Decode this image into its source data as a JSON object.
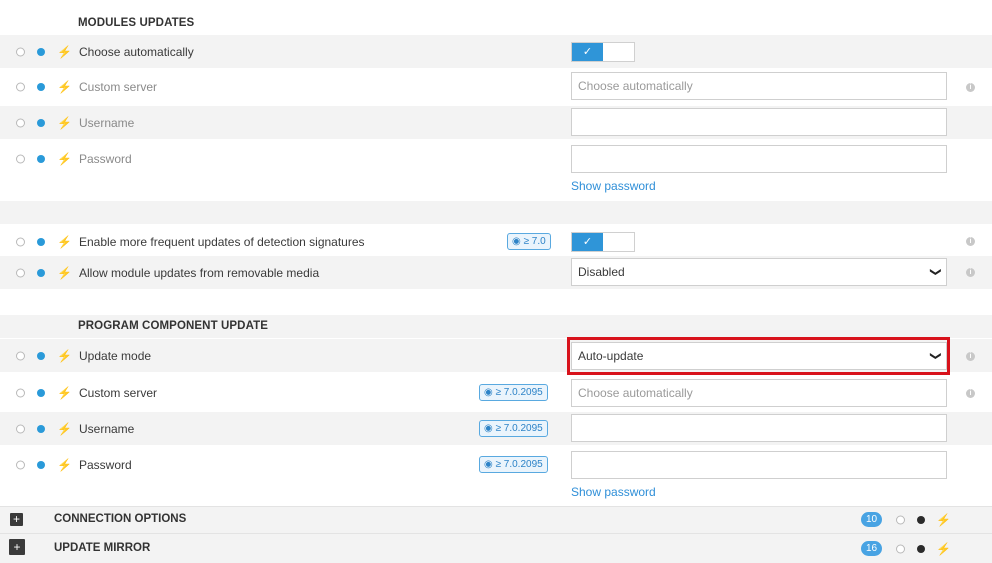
{
  "modules": {
    "section_title": "MODULES UPDATES",
    "choose_auto_label": "Choose automatically",
    "custom_server_label": "Custom server",
    "custom_server_placeholder": "Choose automatically",
    "username_label": "Username",
    "password_label": "Password",
    "show_password": "Show password",
    "frequent_updates_label": "Enable more frequent updates of detection signatures",
    "frequent_updates_badge": "≥ 7.0",
    "removable_media_label": "Allow module updates from removable media",
    "removable_media_value": "Disabled"
  },
  "program": {
    "section_title": "PROGRAM COMPONENT UPDATE",
    "update_mode_label": "Update mode",
    "update_mode_value": "Auto-update",
    "custom_server_label": "Custom server",
    "custom_server_placeholder": "Choose automatically",
    "username_label": "Username",
    "password_label": "Password",
    "version_badge": "≥ 7.0.2095",
    "show_password": "Show password"
  },
  "collapsed": {
    "connection_options": "CONNECTION OPTIONS",
    "connection_count": "10",
    "update_mirror": "UPDATE MIRROR",
    "mirror_count": "16"
  },
  "glyphs": {
    "check": "✓",
    "arrow": "❯",
    "bolt": "⚡",
    "info": "i",
    "plus": "+"
  },
  "colors": {
    "accent": "#2f95d8",
    "highlight": "#d8121b"
  }
}
